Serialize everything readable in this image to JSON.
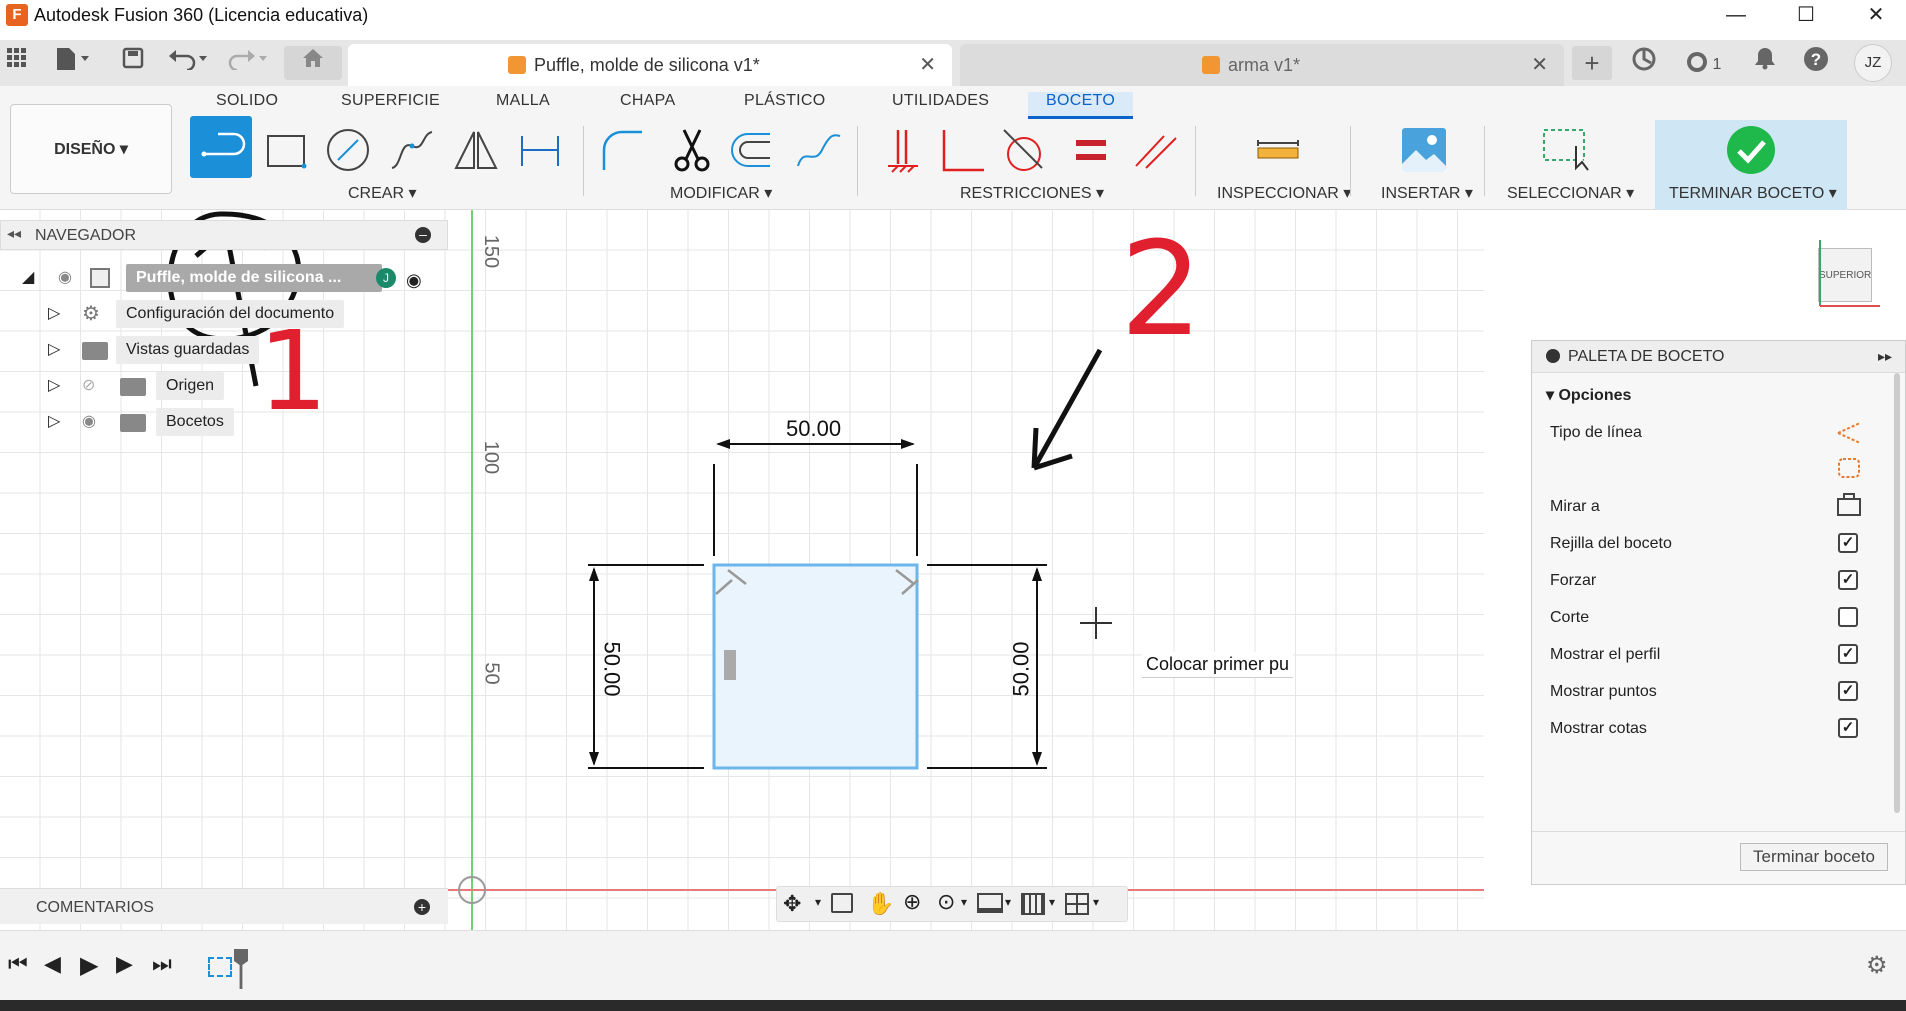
{
  "window": {
    "title": "Autodesk Fusion 360 (Licencia educativa)",
    "app_letter": "F",
    "minimize": "—",
    "maximize": "☐",
    "close": "✕"
  },
  "tabs": [
    {
      "label": "Puffle, molde de silicona v1*",
      "active": true
    },
    {
      "label": "arma v1*",
      "active": false
    }
  ],
  "tabbar": {
    "notification_count": "1",
    "user_initials": "JZ"
  },
  "ribbon": {
    "tabs": [
      "SOLIDO",
      "SUPERFICIE",
      "MALLA",
      "CHAPA",
      "PLÁSTICO",
      "UTILIDADES",
      "BOCETO"
    ],
    "active_tab": "BOCETO",
    "workspace": "DISEÑO",
    "groups": [
      "CREAR",
      "MODIFICAR",
      "RESTRICCIONES",
      "INSPECCIONAR",
      "INSERTAR",
      "SELECCIONAR",
      "TERMINAR BOCETO"
    ]
  },
  "navigator": {
    "title": "NAVEGADOR",
    "root": "Puffle, molde de silicona ...",
    "items": [
      "Configuración del documento",
      "Vistas guardadas",
      "Origen",
      "Bocetos"
    ]
  },
  "canvas": {
    "ruler_labels": [
      "150",
      "100",
      "50"
    ],
    "dimensions": {
      "top": "50.00",
      "left": "50.00",
      "right": "50.00"
    },
    "tooltip": "Colocar primer pu",
    "annotations": [
      "1",
      "2"
    ]
  },
  "viewcube": {
    "label": "SUPERIOR"
  },
  "palette": {
    "title": "PALETA DE BOCETO",
    "section": "Opciones",
    "rows": [
      {
        "label": "Tipo de línea",
        "type": "icon"
      },
      {
        "label": "",
        "type": "icon"
      },
      {
        "label": "Mirar a",
        "type": "icon"
      },
      {
        "label": "Rejilla del boceto",
        "type": "check",
        "checked": true
      },
      {
        "label": "Forzar",
        "type": "check",
        "checked": true
      },
      {
        "label": "Corte",
        "type": "check",
        "checked": false
      },
      {
        "label": "Mostrar el perfil",
        "type": "check",
        "checked": true
      },
      {
        "label": "Mostrar puntos",
        "type": "check",
        "checked": true
      },
      {
        "label": "Mostrar cotas",
        "type": "check",
        "checked": true
      }
    ],
    "finish_button": "Terminar boceto"
  },
  "comments": {
    "title": "COMENTARIOS"
  },
  "colors": {
    "accent": "#0a63c9",
    "selection_blue": "#1b8fd8",
    "axis_green": "#6fce6f",
    "axis_red": "#e87474",
    "annotation_red": "#e0202e"
  }
}
